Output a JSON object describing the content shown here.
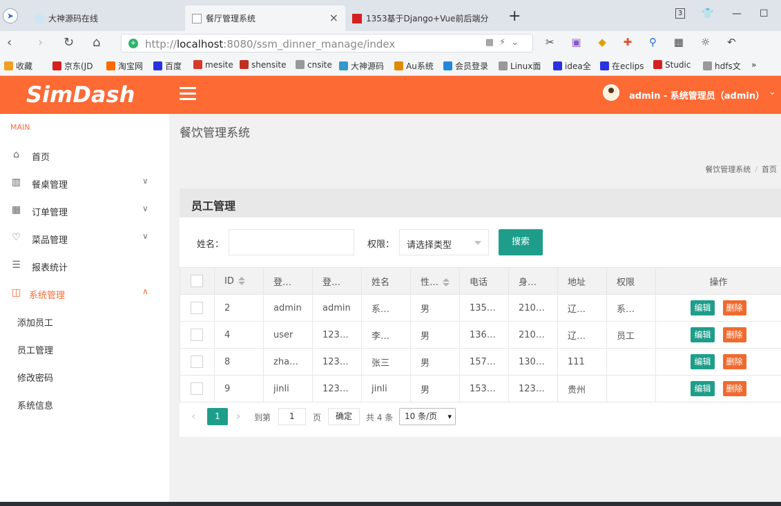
{
  "browser": {
    "tabs": [
      {
        "label": "大神源码在线"
      },
      {
        "label": "餐厅管理系统"
      },
      {
        "label": "1353基于Django+Vue前后端分"
      }
    ],
    "tab_badge": "3",
    "url_scheme": "http://",
    "url_host": "localhost",
    "url_path": ":8080/ssm_dinner_manage/index",
    "bookmarks": [
      {
        "label": "收藏",
        "color": "#f0a020"
      },
      {
        "label": "京东(JD",
        "color": "#d42020"
      },
      {
        "label": "淘宝网",
        "color": "#ff6a00"
      },
      {
        "label": "百度",
        "color": "#2932e1"
      },
      {
        "label": "mesite",
        "color": "#d63a2a"
      },
      {
        "label": "shensite",
        "color": "#c03020"
      },
      {
        "label": "cnsite",
        "color": "#999999"
      },
      {
        "label": "大神源码",
        "color": "#3399cc"
      },
      {
        "label": "Au系统",
        "color": "#e08a00"
      },
      {
        "label": "会员登录",
        "color": "#2288dd"
      },
      {
        "label": "Linux面",
        "color": "#999999"
      },
      {
        "label": "idea全",
        "color": "#2932e1"
      },
      {
        "label": "在eclips",
        "color": "#2932e1"
      },
      {
        "label": "Studic",
        "color": "#d42020"
      },
      {
        "label": "hdfs文",
        "color": "#999999"
      }
    ],
    "bookmarks_more": "»"
  },
  "header": {
    "logo": "SimDash",
    "user": "admin - 系统管理员（admin）",
    "colors": {
      "accent": "#fd6a34",
      "primary": "#1e9e8a",
      "danger": "#f06a2e"
    }
  },
  "sidebar": {
    "title": "MAIN",
    "items": [
      {
        "label": "首页",
        "icon": "home-icon"
      },
      {
        "label": "餐桌管理",
        "icon": "table-icon"
      },
      {
        "label": "订单管理",
        "icon": "grid-icon"
      },
      {
        "label": "菜品管理",
        "icon": "heart-icon"
      },
      {
        "label": "报表统计",
        "icon": "list-icon"
      },
      {
        "label": "系统管理",
        "icon": "layout-icon"
      }
    ],
    "subitems": [
      "添加员工",
      "员工管理",
      "修改密码",
      "系统信息"
    ]
  },
  "main": {
    "page_title": "餐饮管理系统",
    "breadcrumb": [
      "餐饮管理系统",
      "首页"
    ],
    "panel_title": "员工管理",
    "filters": {
      "name_label": "姓名：",
      "name_value": "",
      "role_label": "权限：",
      "role_value": "请选择类型",
      "search_label": "搜索"
    },
    "table": {
      "headers": [
        "ID",
        "登…",
        "登…",
        "姓名",
        "性…",
        "电话",
        "身…",
        "地址",
        "权限",
        "操作"
      ],
      "rows": [
        [
          "2",
          "admin",
          "admin",
          "系…",
          "男",
          "135…",
          "210…",
          "辽…",
          "系…"
        ],
        [
          "4",
          "user",
          "123…",
          "李…",
          "男",
          "136…",
          "210…",
          "辽…",
          "员工"
        ],
        [
          "8",
          "zha…",
          "123…",
          "张三",
          "男",
          "157…",
          "130…",
          "111",
          ""
        ],
        [
          "9",
          "jinli",
          "123…",
          "jinli",
          "男",
          "153…",
          "123…",
          "贵州",
          ""
        ]
      ],
      "edit_label": "编辑",
      "delete_label": "删除"
    },
    "pagination": {
      "current": "1",
      "goto_label": "到第",
      "page_input": "1",
      "page_unit": "页",
      "confirm": "确定",
      "total": "共 4 条",
      "page_size": "10 条/页"
    }
  }
}
